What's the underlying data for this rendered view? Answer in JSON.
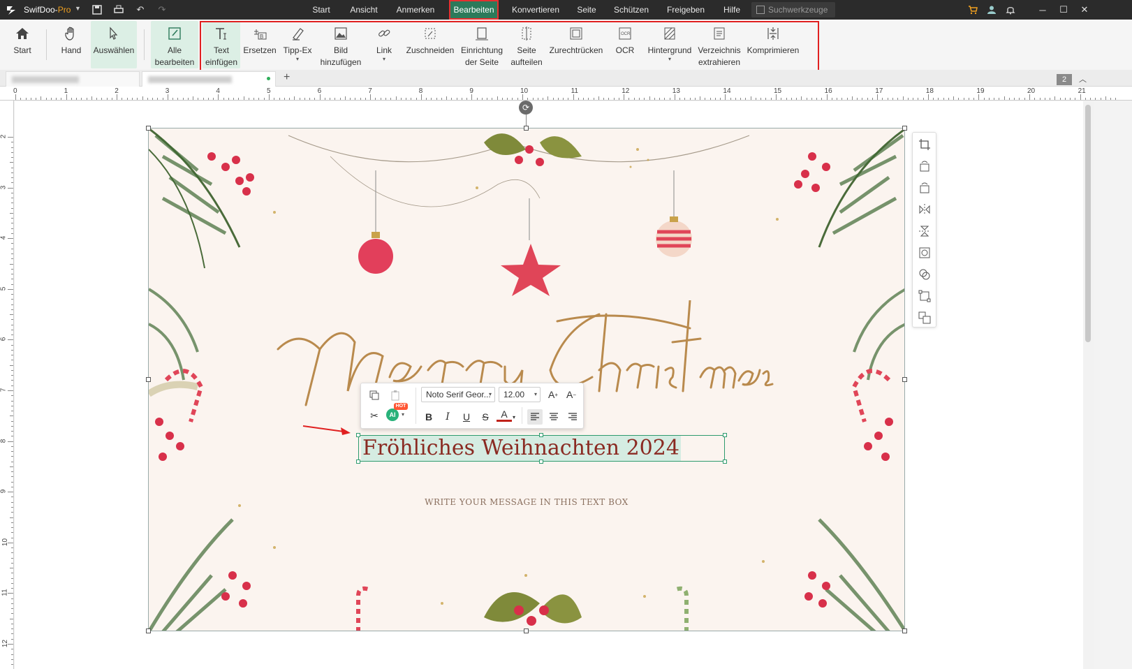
{
  "titlebar": {
    "app_name": "SwifDoo-",
    "app_edition": "Pro",
    "menus": [
      "Start",
      "Ansicht",
      "Anmerken",
      "Bearbeiten",
      "Konvertieren",
      "Seite",
      "Schützen",
      "Freigeben",
      "Hilfe"
    ],
    "active_menu": "Bearbeiten",
    "search_placeholder": "Suchwerkzeuge"
  },
  "ribbon": {
    "items": [
      {
        "label": "Start",
        "icon": "home-icon"
      },
      {
        "label": "Hand",
        "icon": "hand-icon"
      },
      {
        "label": "Auswählen",
        "icon": "cursor-icon"
      },
      {
        "label": "Alle\nbearbeiten",
        "icon": "edit-all-icon"
      },
      {
        "label": "Text\neinfügen",
        "icon": "text-insert-icon"
      },
      {
        "label": "Ersetzen",
        "icon": "replace-icon"
      },
      {
        "label": "Tipp-Ex",
        "icon": "eraser-icon"
      },
      {
        "label": "Bild\nhinzufügen",
        "icon": "image-add-icon"
      },
      {
        "label": "Link",
        "icon": "link-icon"
      },
      {
        "label": "Zuschneiden",
        "icon": "crop-icon"
      },
      {
        "label": "Einrichtung\nder Seite",
        "icon": "page-setup-icon"
      },
      {
        "label": "Seite\naufteilen",
        "icon": "split-page-icon"
      },
      {
        "label": "Zurechtrücken",
        "icon": "deskew-icon"
      },
      {
        "label": "OCR",
        "icon": "ocr-icon"
      },
      {
        "label": "Hintergrund",
        "icon": "background-icon"
      },
      {
        "label": "Verzeichnis\nextrahieren",
        "icon": "extract-toc-icon"
      },
      {
        "label": "Komprimieren",
        "icon": "compress-icon"
      }
    ]
  },
  "tabs": {
    "page_count": "2"
  },
  "ruler": {
    "h_numbers": [
      "0",
      "1",
      "2",
      "3",
      "4",
      "5",
      "6",
      "7",
      "8",
      "9",
      "10",
      "11",
      "12",
      "13",
      "14",
      "15",
      "16",
      "17",
      "18",
      "19",
      "20",
      "21"
    ],
    "v_numbers": [
      "2",
      "3",
      "4",
      "5",
      "6",
      "7",
      "8",
      "9",
      "10",
      "11",
      "12"
    ]
  },
  "document": {
    "greeting": "Fröhliches Weihnachten 2024",
    "message": "WRITE YOUR MESSAGE IN THIS TEXT BOX",
    "headline_script": "Merry Christmas"
  },
  "format_toolbar": {
    "font": "Noto Serif Geor...",
    "size": "12.00",
    "ai_label": "AI",
    "hot_label": "HOT",
    "bold": "B",
    "italic": "I",
    "underline": "U",
    "strike": "S",
    "color": "A",
    "text_color": "#c0221a"
  },
  "colors": {
    "accent": "#2c7a5a",
    "highlight_box": "#e02020",
    "greeting_text": "#8a2a22"
  }
}
